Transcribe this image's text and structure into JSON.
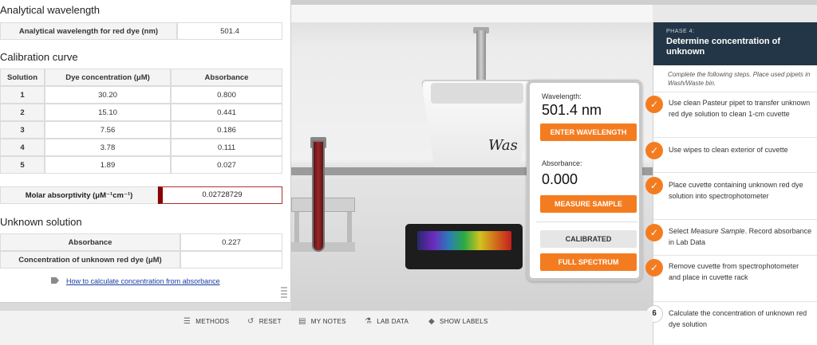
{
  "left_panel": {
    "analytical_title": "Analytical wavelength",
    "analytical_label": "Analytical wavelength for red dye (nm)",
    "analytical_value": "501.4",
    "calibration_title": "Calibration curve",
    "columns": [
      "Solution",
      "Dye concentration (μM)",
      "Absorbance"
    ],
    "rows": [
      {
        "solution": "1",
        "conc": "30.20",
        "abs": "0.800"
      },
      {
        "solution": "2",
        "conc": "15.10",
        "abs": "0.441"
      },
      {
        "solution": "3",
        "conc": "7.56",
        "abs": "0.186"
      },
      {
        "solution": "4",
        "conc": "3.78",
        "abs": "0.111"
      },
      {
        "solution": "5",
        "conc": "1.89",
        "abs": "0.027"
      }
    ],
    "molar_label": "Molar absorptivity (μM⁻¹cm⁻¹)",
    "molar_value": "0.02728729",
    "unknown_title": "Unknown solution",
    "absorbance_label": "Absorbance",
    "absorbance_value": "0.227",
    "concentration_label": "Concentration of unknown red dye (μM)",
    "concentration_value": "",
    "how_link": "How to calculate concentration from absorbance"
  },
  "scene": {
    "sink_text": "Was"
  },
  "instrument": {
    "wavelength_label": "Wavelength:",
    "wavelength_value": "501.4 nm",
    "enter_wavelength": "ENTER WAVELENGTH",
    "absorbance_label": "Absorbance:",
    "absorbance_value": "0.000",
    "measure_sample": "MEASURE SAMPLE",
    "calibrated": "CALIBRATED",
    "full_spectrum": "FULL SPECTRUM"
  },
  "sidebar": {
    "phase_label": "PHASE 4:",
    "phase_title": "Determine concentration of unknown",
    "instructions": "Complete the following steps. Place used pipets in Wash/Waste bin.",
    "steps": [
      {
        "status": "done",
        "text": "Use clean Pasteur pipet to transfer unknown red dye solution to clean 1-cm cuvette"
      },
      {
        "status": "done",
        "text": "Use wipes to clean exterior of cuvette"
      },
      {
        "status": "done",
        "text": "Place cuvette containing unknown red dye solution into spectrophotometer"
      },
      {
        "status": "done",
        "text_pre": "Select ",
        "text_em": "Measure Sample",
        "text_post": ". Record absorbance in Lab Data"
      },
      {
        "status": "done",
        "text": "Remove cuvette from spectrophotometer and place in cuvette rack"
      },
      {
        "status": "todo",
        "number": "6",
        "text": "Calculate the concentration of unknown red dye solution"
      }
    ],
    "check_glyph": "✓"
  },
  "toolbar": {
    "methods": "METHODS",
    "reset": "RESET",
    "my_notes": "MY NOTES",
    "lab_data": "LAB DATA",
    "show_labels": "SHOW LABELS"
  },
  "colors": {
    "accent": "#f47c20",
    "phase_bg": "#233647",
    "link": "#1a3ea0"
  }
}
